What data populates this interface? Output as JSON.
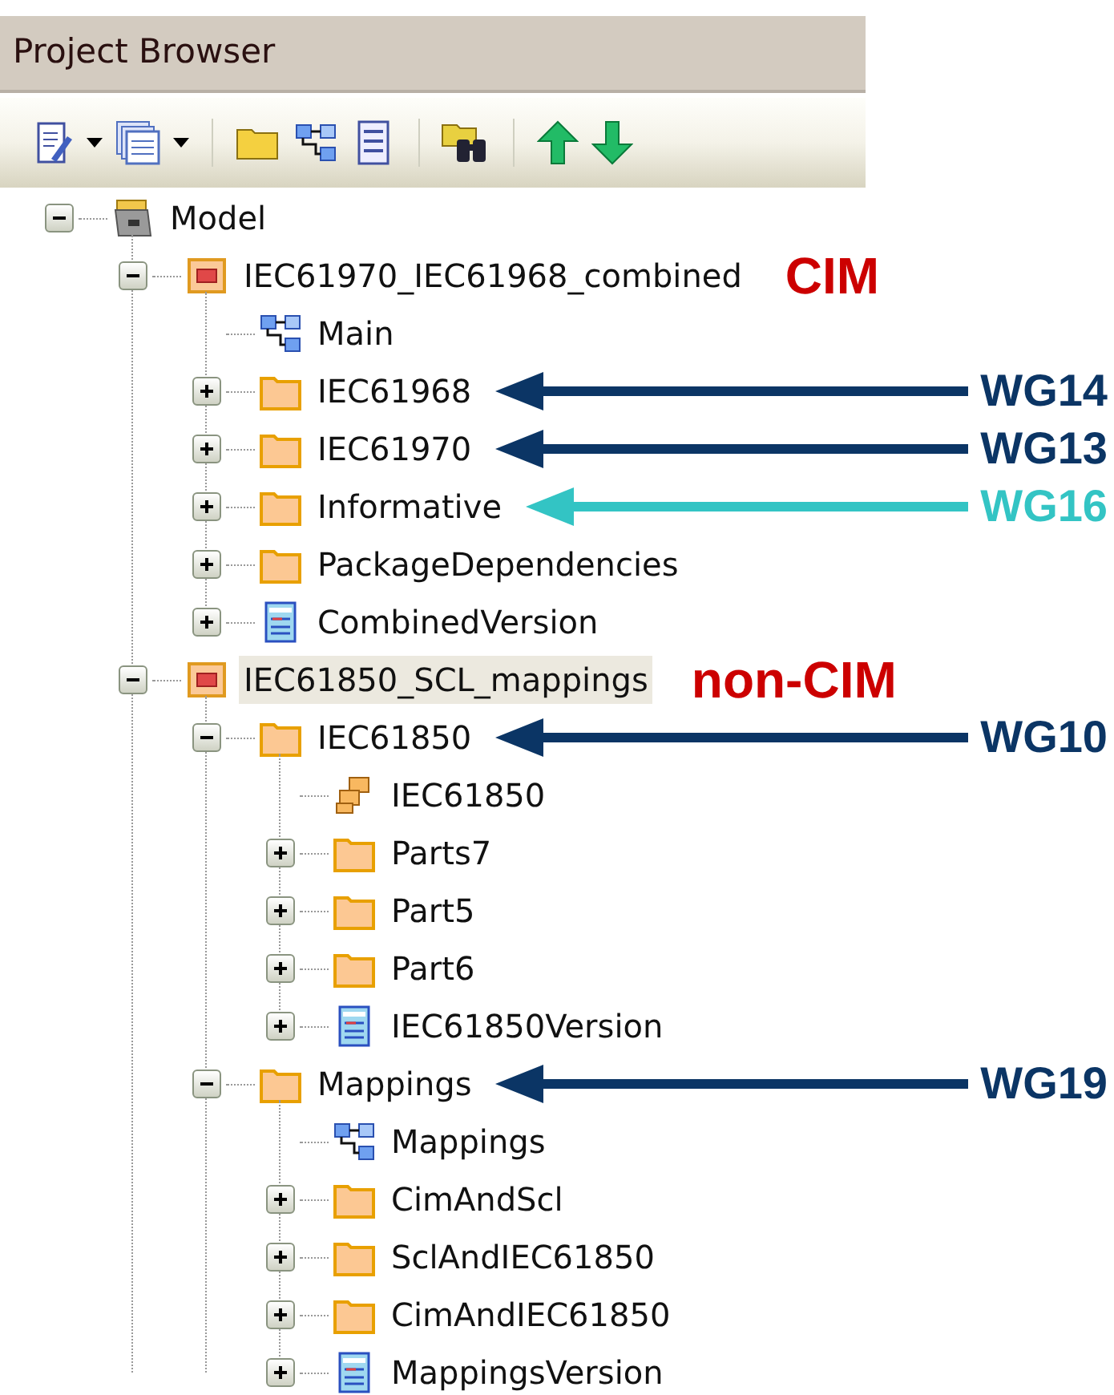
{
  "window": {
    "title": "Project Browser"
  },
  "toolbar": [
    {
      "kind": "new-doc"
    },
    {
      "kind": "caret"
    },
    {
      "kind": "docs"
    },
    {
      "kind": "caret"
    },
    {
      "kind": "sep"
    },
    {
      "kind": "folder"
    },
    {
      "kind": "diagram"
    },
    {
      "kind": "list"
    },
    {
      "kind": "sep"
    },
    {
      "kind": "find"
    },
    {
      "kind": "sep"
    },
    {
      "kind": "up"
    },
    {
      "kind": "down"
    }
  ],
  "tree": [
    {
      "label": "Model",
      "kind": "model",
      "expanded": true,
      "selected": false,
      "children": [
        {
          "label": "IEC61970_IEC61968_combined",
          "kind": "package",
          "expanded": true,
          "selected": false,
          "annotation": {
            "kind": "tag",
            "label": "CIM",
            "color": "#cc0000"
          },
          "children": [
            {
              "label": "Main",
              "kind": "diagram",
              "selected": false
            },
            {
              "label": "IEC61968",
              "kind": "folder",
              "expanded": false,
              "selected": false,
              "annotation": {
                "kind": "arrow",
                "label": "WG14",
                "color": "#0b3565"
              }
            },
            {
              "label": "IEC61970",
              "kind": "folder",
              "expanded": false,
              "selected": false,
              "annotation": {
                "kind": "arrow",
                "label": "WG13",
                "color": "#0b3565"
              }
            },
            {
              "label": "Informative",
              "kind": "folder",
              "expanded": false,
              "selected": false,
              "annotation": {
                "kind": "arrow",
                "label": "WG16",
                "color": "#33c4c4"
              }
            },
            {
              "label": "PackageDependencies",
              "kind": "folder",
              "expanded": false,
              "selected": false
            },
            {
              "label": "CombinedVersion",
              "kind": "version",
              "expanded": false,
              "selected": false
            }
          ]
        },
        {
          "label": "IEC61850_SCL_mappings",
          "kind": "package",
          "expanded": true,
          "selected": true,
          "annotation": {
            "kind": "tag",
            "label": "non-CIM",
            "color": "#cc0000"
          },
          "children": [
            {
              "label": "IEC61850",
              "kind": "folder",
              "expanded": true,
              "selected": false,
              "annotation": {
                "kind": "arrow",
                "label": "WG10",
                "color": "#0b3565"
              },
              "children": [
                {
                  "label": "IEC61850",
                  "kind": "class",
                  "selected": false
                },
                {
                  "label": "Parts7",
                  "kind": "folder",
                  "expanded": false,
                  "selected": false
                },
                {
                  "label": "Part5",
                  "kind": "folder",
                  "expanded": false,
                  "selected": false
                },
                {
                  "label": "Part6",
                  "kind": "folder",
                  "expanded": false,
                  "selected": false
                },
                {
                  "label": "IEC61850Version",
                  "kind": "version",
                  "expanded": false,
                  "selected": false
                }
              ]
            },
            {
              "label": "Mappings",
              "kind": "folder",
              "expanded": true,
              "selected": false,
              "annotation": {
                "kind": "arrow",
                "label": "WG19",
                "color": "#0b3565"
              },
              "children": [
                {
                  "label": "Mappings",
                  "kind": "diagram",
                  "selected": false
                },
                {
                  "label": "CimAndScl",
                  "kind": "folder",
                  "expanded": false,
                  "selected": false
                },
                {
                  "label": "SclAndIEC61850",
                  "kind": "folder",
                  "expanded": false,
                  "selected": false
                },
                {
                  "label": "CimAndIEC61850",
                  "kind": "folder",
                  "expanded": false,
                  "selected": false
                },
                {
                  "label": "MappingsVersion",
                  "kind": "version",
                  "expanded": false,
                  "selected": false
                }
              ]
            }
          ]
        }
      ]
    }
  ]
}
